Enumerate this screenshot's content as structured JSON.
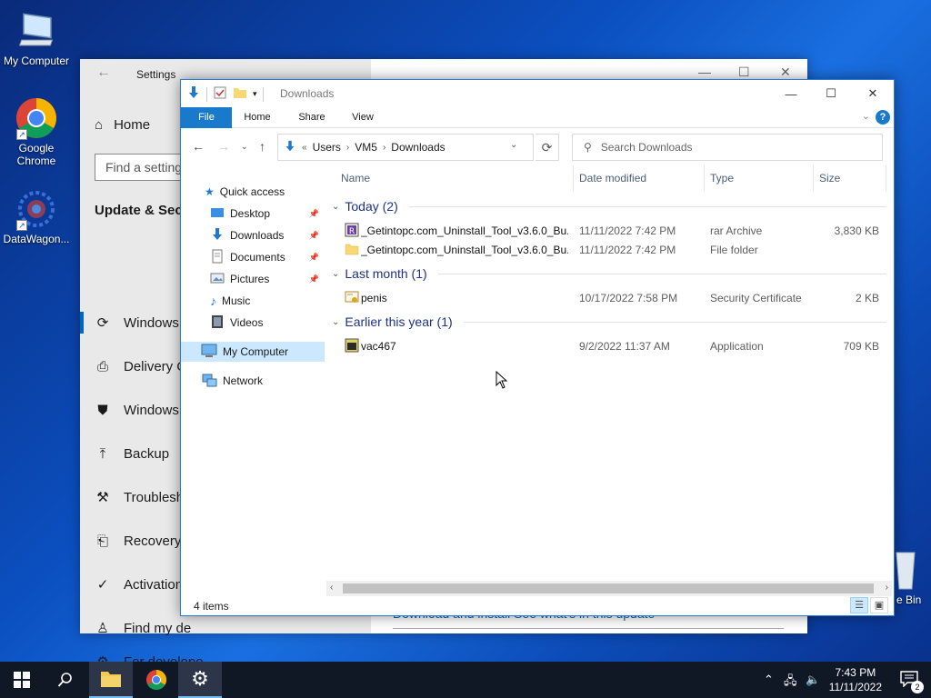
{
  "desktop": {
    "icons": [
      {
        "label": "My Computer",
        "icon": "computer-icon"
      },
      {
        "label": "Google Chrome",
        "icon": "chrome-icon"
      },
      {
        "label": "DataWagon...",
        "icon": "datawagon-icon"
      }
    ],
    "recycle_partial": "e Bin"
  },
  "settings": {
    "title": "Settings",
    "home": "Home",
    "search_placeholder": "Find a setting",
    "section": "Update & Secu",
    "items": [
      "Windows U",
      "Delivery O",
      "Windows S",
      "Backup",
      "Troublesho",
      "Recovery",
      "Activation",
      "Find my de",
      "For develope"
    ],
    "link_text": "Download and install    See what's in this update"
  },
  "explorer": {
    "title": "Downloads",
    "ribbon_tabs": [
      "File",
      "Home",
      "Share",
      "View"
    ],
    "breadcrumb": [
      "Users",
      "VM5",
      "Downloads"
    ],
    "search_placeholder": "Search Downloads",
    "nav": {
      "quick_access": "Quick access",
      "items": [
        "Desktop",
        "Downloads",
        "Documents",
        "Pictures",
        "Music",
        "Videos"
      ],
      "my_computer": "My Computer",
      "network": "Network"
    },
    "columns": [
      "Name",
      "Date modified",
      "Type",
      "Size"
    ],
    "groups": [
      {
        "label": "Today (2)",
        "files": [
          {
            "name": "_Getintopc.com_Uninstall_Tool_v3.6.0_Bu...",
            "date": "11/11/2022 7:42 PM",
            "type": "rar Archive",
            "size": "3,830 KB",
            "icon": "rar-archive-icon"
          },
          {
            "name": "_Getintopc.com_Uninstall_Tool_v3.6.0_Bu...",
            "date": "11/11/2022 7:42 PM",
            "type": "File folder",
            "size": "",
            "icon": "folder-icon"
          }
        ]
      },
      {
        "label": "Last month (1)",
        "files": [
          {
            "name": "penis",
            "date": "10/17/2022 7:58 PM",
            "type": "Security Certificate",
            "size": "2 KB",
            "icon": "certificate-icon"
          }
        ]
      },
      {
        "label": "Earlier this year (1)",
        "files": [
          {
            "name": "vac467",
            "date": "9/2/2022 11:37 AM",
            "type": "Application",
            "size": "709 KB",
            "icon": "application-icon"
          }
        ]
      }
    ],
    "status": "4 items"
  },
  "taskbar": {
    "time": "7:43 PM",
    "date": "11/11/2022",
    "notifications": "2"
  },
  "colors": {
    "accent": "#1979ca",
    "selection": "#cce8ff",
    "group_header": "#1e3287",
    "taskbar": "#101826"
  }
}
